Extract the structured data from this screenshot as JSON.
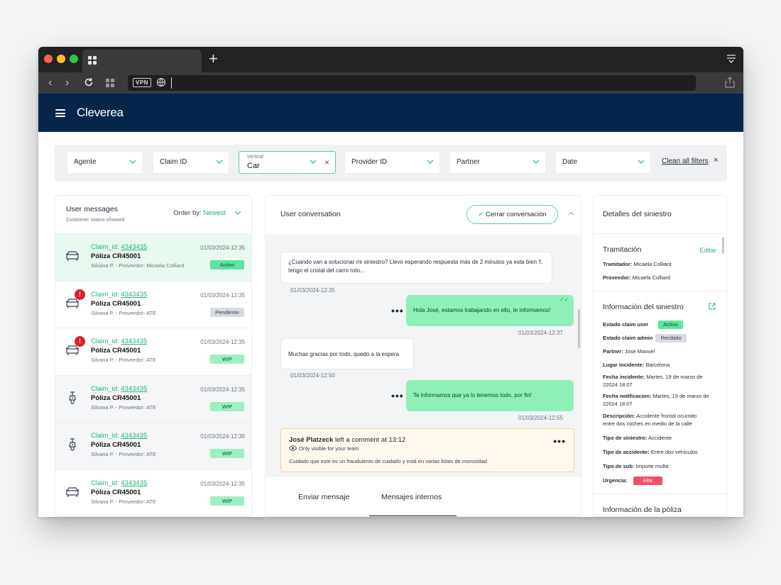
{
  "app": {
    "name": "Cleverea"
  },
  "filters": {
    "agente": "Agente",
    "claim_id": "Claim ID",
    "vertical_label": "Vertical",
    "vertical_value": "Car",
    "provider_id": "Provider ID",
    "partner": "Partner",
    "date": "Date",
    "clear_all": "Clean all filters",
    "clear_x": "×"
  },
  "messages_panel": {
    "title": "User messages",
    "subtitle": "Customer status showed",
    "order_label": "Order by:",
    "order_value": "Newest",
    "items": [
      {
        "vehicle": "car-icon",
        "alert": "",
        "claim_prefix": "Claim_id: ",
        "claim_id": "4343435",
        "poliza": "Póliza CR45001",
        "meta": "Silvana P. - Proveedor: Micaela Colliard",
        "date": "01/03/2024-12:35",
        "status": "Activo"
      },
      {
        "vehicle": "car-icon",
        "alert": "!",
        "claim_prefix": "Claim_id: ",
        "claim_id": "4343435",
        "poliza": "Póliza CR45001",
        "meta": "Silvana P. - Proveedor: ATE",
        "date": "01/03/2024-12:35",
        "status": "Pendiente"
      },
      {
        "vehicle": "car-icon",
        "alert": "!",
        "claim_prefix": "Claim_id: ",
        "claim_id": "4343435",
        "poliza": "Póliza CR45001",
        "meta": "Silvana P. - Proveedor: ATE",
        "date": "01/03/2024-12:35",
        "status": "WIP"
      },
      {
        "vehicle": "scooter-icon",
        "alert": "",
        "claim_prefix": "Claim_id: ",
        "claim_id": "4343435",
        "poliza": "Póliza CR45001",
        "meta": "Silvana P. - Proveedor: ATE",
        "date": "01/03/2024-12:35",
        "status": "WIP"
      },
      {
        "vehicle": "scooter-icon",
        "alert": "",
        "claim_prefix": "Claim_id: ",
        "claim_id": "4343435",
        "poliza": "Póliza CR45001",
        "meta": "Silvana P. - Proveedor: ATE",
        "date": "01/03/2024-12:35",
        "status": "WIP"
      },
      {
        "vehicle": "car-icon",
        "alert": "",
        "claim_prefix": "Claim_id: ",
        "claim_id": "4343435",
        "poliza": "Póliza CR45001",
        "meta": "Silvana P. - Proveedor: ATE",
        "date": "01/03/2024-12:35",
        "status": "WIP"
      }
    ]
  },
  "conversation": {
    "title": "User conversation",
    "close_button": "Cerrar conversación",
    "close_check": "✓",
    "messages": [
      {
        "text_line1": "¿Cuando van a solucionar mi siniestro? Llevo esperando respuesta más de 2 minutos ya esta bien !!,",
        "text_line2": "tengo el cristal del carro roto...",
        "time": "01/03/2024-12:35"
      },
      {
        "text": "Hola José, estamos trabajando en ello, te informamos!",
        "time": "01/03/2024-12:37",
        "ticks": "✓✓"
      },
      {
        "text": "Muchas gracias por todo, quedo a la espera",
        "time": "01/03/2024-12:50"
      },
      {
        "text": "Te informamos que ya lo tenemos todo, por fin!",
        "time": "01/03/2024-12:55"
      }
    ],
    "dots": "•••",
    "comment": {
      "author": "José Platzeck",
      "action": " left a comment at 13:12",
      "visibility": "Only visible for your team",
      "text": "Cuidado que este es un fraudulento de cuidado y está en varias listas de morosidad"
    },
    "tabs": [
      "Enviar mensaje",
      "Mensajes internos"
    ]
  },
  "details": {
    "title": "Detalles del siniestro",
    "tramitacion": {
      "title": "Tramitación",
      "edit": "Editar",
      "tramitador_label": "Tramitador:",
      "tramitador": "Micaela Colliard",
      "proveedor_label": "Proveedor:",
      "proveedor": "Micaela Colliard"
    },
    "informacion": {
      "title": "Información del siniestro",
      "estado_user_label": "Estado claim user",
      "estado_user": "Activo",
      "estado_admin_label": "Estado claim admin",
      "estado_admin": "Recibido",
      "partner_label": "Partner:",
      "partner": "Jose Manuel",
      "lugar_label": "Lugar incidente:",
      "lugar": "Barcelona",
      "fecha_inc_label": "Fecha incidente:",
      "fecha_inc": "Martes, 19 de marzo de",
      "fecha_inc_2": "22024 18:07",
      "fecha_not_label": "Fecha notificacion:",
      "fecha_not": "Martes, 19 de marzo de",
      "fecha_not_2": "22024 18:07",
      "desc_label": "Descripción:",
      "desc": "Accidente frontal ocurrido",
      "desc_2": "entre dos coches en medio de la calle",
      "tipo_sin_label": "Tipo de siniestro:",
      "tipo_sin": "Accidente",
      "tipo_acc_label": "Tipo de accidente:",
      "tipo_acc": "Entre dos vehículos",
      "tipo_sub_label": "Tipo de sub:",
      "tipo_sub": "Importe multa",
      "urgencia_label": "Urgencia:",
      "urgencia": "Alta"
    },
    "poliza_title": "Información de la póliza"
  }
}
